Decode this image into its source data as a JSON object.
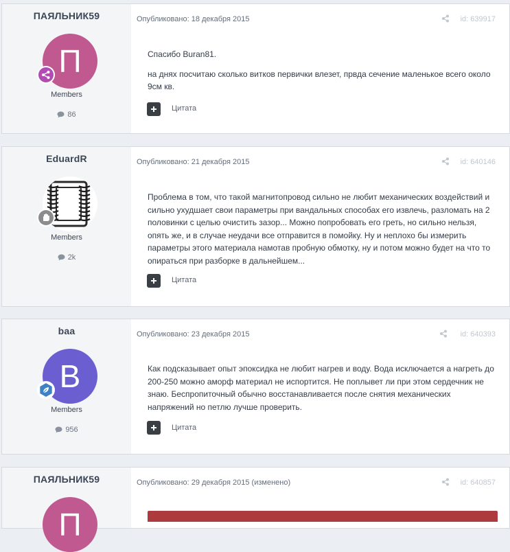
{
  "posts": [
    {
      "author": "ПАЯЛЬНИК59",
      "avatar_letter": "П",
      "avatar_color": "#c0598f",
      "badge_color": "#b34bb5",
      "badge_icon": "share-nodes-icon",
      "group": "Members",
      "post_count": "86",
      "published": "Опубликовано: 18 декабря 2015",
      "id_label": "id: 639917",
      "paragraphs": [
        "Спасибо Buran81.",
        "на днях посчитаю сколько витков первички влезет, првда сечение маленькое всего около 9см кв."
      ],
      "quote_label": "Цитата"
    },
    {
      "author": "EduardR",
      "avatar_image": "transformer-core-drawing",
      "badge_color": "#8c8c8c",
      "badge_icon": "hand-icon",
      "group": "Members",
      "post_count": "2k",
      "published": "Опубликовано: 21 декабря 2015",
      "id_label": "id: 640146",
      "paragraphs": [
        "Проблема в том, что такой магнитопровод сильно не любит механических воздействий и сильно ухудшает свои параметры при вандальных способах его извлечь, разломать на 2 половинки с целью очистить зазор... Можно попробовать его греть, но сильно нельзя, опять же, и в случае неудачи все отправится в помойку. Ну и неплохо бы измерить параметры этого материала намотав пробную обмотку, ну и потом можно будет на что то опираться при разборке в дальнейшем..."
      ],
      "quote_label": "Цитата"
    },
    {
      "author": "baa",
      "avatar_letter": "B",
      "avatar_color": "#6a5ed1",
      "badge_color": "#3f82c4",
      "badge_icon": "leaf-icon",
      "group": "Members",
      "post_count": "956",
      "published": "Опубликовано: 23 декабря 2015",
      "id_label": "id: 640393",
      "paragraphs": [
        "Как подсказывает опыт эпоксидка не любит нагрев и воду. Вода исключается а нагреть до 200-250 можно аморф материал не испортится. Не поплывет ли при этом сердечник не знаю. Беспропиточный обычно восстанавливается после снятия механических напряжений но петлю лучше проверить."
      ],
      "quote_label": "Цитата"
    },
    {
      "author": "ПАЯЛЬНИК59",
      "avatar_letter": "П",
      "avatar_color": "#c0598f",
      "published": "Опубликовано: 29 декабря 2015 (изменено)",
      "id_label": "id: 640857",
      "attachment_color": "#ad3a3c"
    }
  ]
}
